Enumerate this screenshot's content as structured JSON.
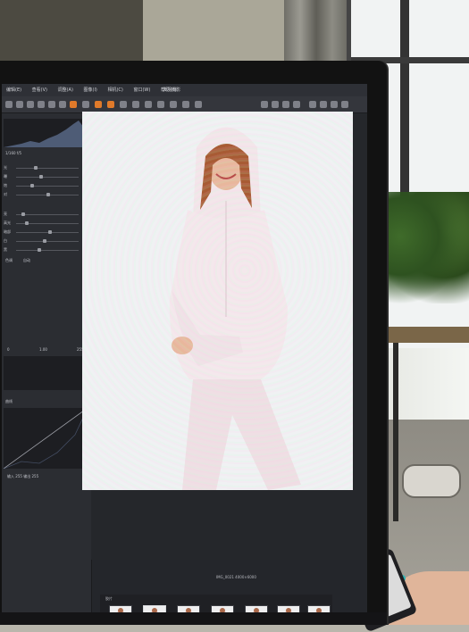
{
  "app": {
    "title": "天羽摄影",
    "menu": [
      "编辑(E)",
      "查看(V)",
      "调整(A)",
      "图像(I)",
      "相机(C)",
      "窗口(W)",
      "帮助(H)"
    ]
  },
  "left_panel": {
    "hist_readout": "1/160  f/5",
    "adjust_labels": [
      "光",
      "曝",
      "饱",
      "对",
      "亮",
      "高光",
      "暗部",
      "白",
      "黑",
      "色调",
      "曲线"
    ],
    "tone_mode": "自动",
    "levels_values": [
      "0",
      "1.00",
      "255"
    ],
    "curve_readout": [
      "输入",
      "255",
      "输出",
      "255"
    ]
  },
  "canvas": {
    "photo_caption": "IMG_0021 4000×6000"
  },
  "filmstrip": {
    "label": "胶片",
    "count": 7
  },
  "colors": {
    "accent": "#e07a2a",
    "panel": "#2b2d32",
    "bg": "#24262b"
  }
}
